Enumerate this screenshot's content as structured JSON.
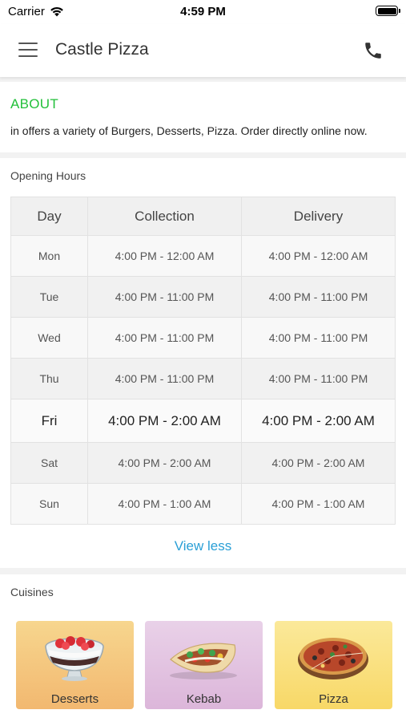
{
  "status_bar": {
    "carrier": "Carrier",
    "time": "4:59 PM"
  },
  "header": {
    "title": "Castle Pizza",
    "menu_icon": "hamburger-menu-icon",
    "phone_icon": "phone-icon"
  },
  "about": {
    "title": "ABOUT",
    "text": "in  offers a variety of Burgers, Desserts, Pizza. Order directly online now.",
    "accent_color": "#22c03a"
  },
  "opening_hours": {
    "title": "Opening Hours",
    "columns": [
      "Day",
      "Collection",
      "Delivery"
    ],
    "rows": [
      {
        "day": "Mon",
        "collection": "4:00 PM - 12:00 AM",
        "delivery": "4:00 PM - 12:00 AM"
      },
      {
        "day": "Tue",
        "collection": "4:00 PM - 11:00 PM",
        "delivery": "4:00 PM - 11:00 PM"
      },
      {
        "day": "Wed",
        "collection": "4:00 PM - 11:00 PM",
        "delivery": "4:00 PM - 11:00 PM"
      },
      {
        "day": "Thu",
        "collection": "4:00 PM - 11:00 PM",
        "delivery": "4:00 PM - 11:00 PM"
      },
      {
        "day": "Fri",
        "collection": "4:00 PM - 2:00 AM",
        "delivery": "4:00 PM - 2:00 AM"
      },
      {
        "day": "Sat",
        "collection": "4:00 PM - 2:00 AM",
        "delivery": "4:00 PM - 2:00 AM"
      },
      {
        "day": "Sun",
        "collection": "4:00 PM - 1:00 AM",
        "delivery": "4:00 PM - 1:00 AM"
      }
    ],
    "today": "Fri",
    "view_less_label": "View less",
    "link_color": "#2a9fd6"
  },
  "cuisines": {
    "title": "Cuisines",
    "items": [
      {
        "label": "Desserts",
        "icon": "dessert-bowl-icon"
      },
      {
        "label": "Kebab",
        "icon": "kebab-wrap-icon"
      },
      {
        "label": "Pizza",
        "icon": "pizza-icon"
      }
    ]
  }
}
